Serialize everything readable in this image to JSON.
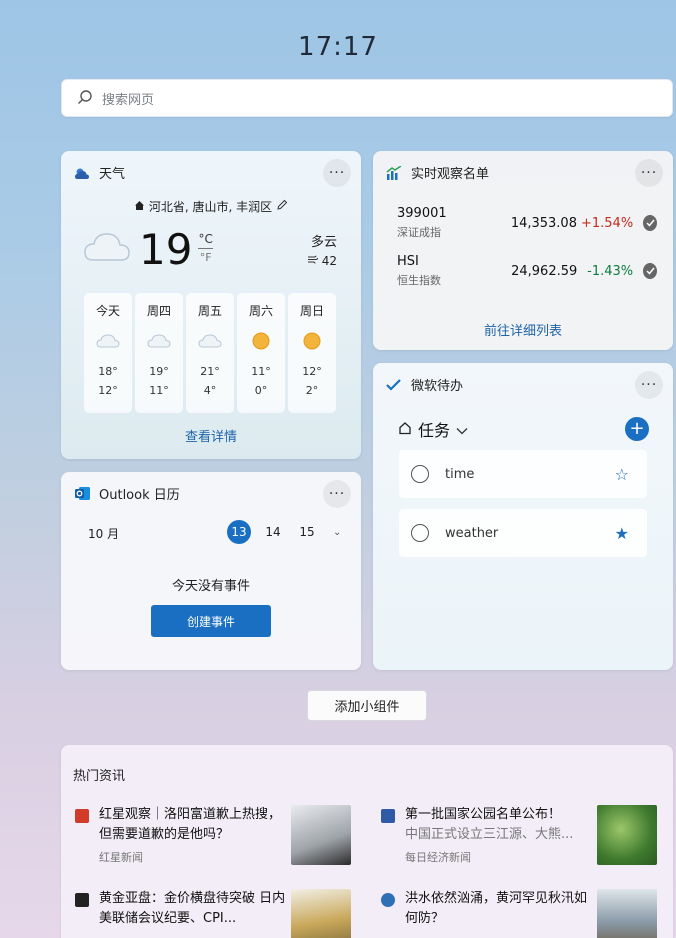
{
  "clock": "17:17",
  "search": {
    "placeholder": "搜索网页"
  },
  "weather": {
    "title": "天气",
    "location": "河北省, 唐山市, 丰润区",
    "temperature": "19",
    "unit_c": "°C",
    "unit_f": "°F",
    "condition": "多云",
    "aqi": "42",
    "forecast": [
      {
        "day": "今天",
        "icon": "cloudy-icon",
        "high": "18°",
        "low": "12°"
      },
      {
        "day": "周四",
        "icon": "cloudy-icon",
        "high": "19°",
        "low": "11°"
      },
      {
        "day": "周五",
        "icon": "cloudy-icon",
        "high": "21°",
        "low": "4°"
      },
      {
        "day": "周六",
        "icon": "sunny-icon",
        "high": "11°",
        "low": "0°"
      },
      {
        "day": "周日",
        "icon": "sunny-icon",
        "high": "12°",
        "low": "2°"
      }
    ],
    "details_link": "查看详情"
  },
  "stocks": {
    "title": "实时观察名单",
    "items": [
      {
        "symbol": "399001",
        "name": "深证成指",
        "price": "14,353.08",
        "change": "+1.54%",
        "color": "#c42b1c"
      },
      {
        "symbol": "HSI",
        "name": "恒生指数",
        "price": "24,962.59",
        "change": "-1.43%",
        "color": "#0f7b3f"
      }
    ],
    "link": "前往详细列表"
  },
  "todo": {
    "title": "微软待办",
    "list_name": "任务",
    "tasks": [
      {
        "title": "time",
        "starred": false
      },
      {
        "title": "weather",
        "starred": true
      }
    ]
  },
  "outlook": {
    "title": "Outlook 日历",
    "month": "10 月",
    "days": [
      "13",
      "14",
      "15"
    ],
    "selected_day": "13",
    "no_events": "今天没有事件",
    "create_button": "创建事件"
  },
  "add_widget": "添加小组件",
  "news": {
    "title": "热门资讯",
    "items": [
      {
        "title": "红星观察｜洛阳富道歉上热搜，但需要道歉的是他吗？",
        "source": "红星新闻",
        "icon_color": "#d23b2a",
        "thumb_color": "#c7c9cc"
      },
      {
        "title": "第一批国家公园名单公布！",
        "subtitle": "中国正式设立三江源、大熊...",
        "source": "每日经济新闻",
        "icon_color": "#2f5aa6",
        "thumb_color": "#4e8a3a"
      },
      {
        "title": "黄金亚盘：金价横盘待突破 日内美联储会议纪要、CPI...",
        "source": "",
        "icon_color": "#222222",
        "thumb_color": "#b99a52"
      },
      {
        "title": "洪水依然汹涌，黄河罕见秋汛如何防？",
        "source": "",
        "icon_color": "#2f6fb5",
        "thumb_color": "#8a9aa8"
      }
    ]
  }
}
